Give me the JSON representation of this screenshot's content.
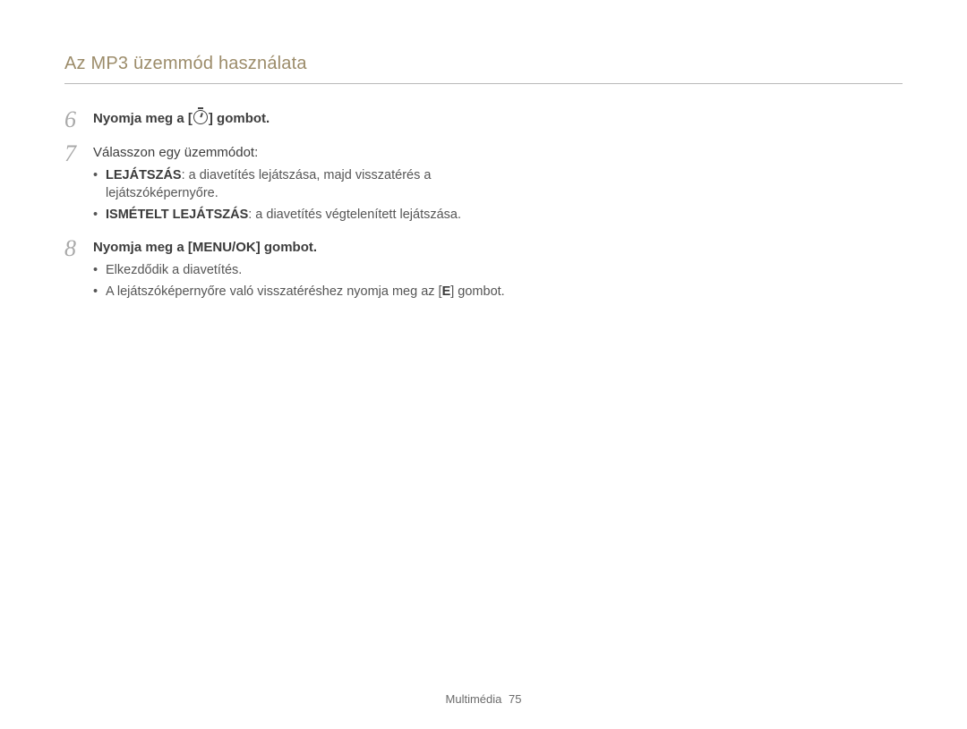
{
  "header": {
    "title": "Az MP3 üzemmód használata"
  },
  "steps": [
    {
      "num": "6",
      "head_pre": "Nyomja meg a [",
      "head_post": "] gombot.",
      "icon": "timer-icon"
    },
    {
      "num": "7",
      "head": "Válasszon egy üzemmódot:",
      "bullets": [
        {
          "bold": "LEJÁTSZÁS",
          "rest": ": a diavetítés lejátszása, majd visszatérés a lejátszóképernyőre."
        },
        {
          "bold": "ISMÉTELT LEJÁTSZÁS",
          "rest": ": a diavetítés végtelenített lejátszása."
        }
      ]
    },
    {
      "num": "8",
      "head_parts": [
        "Nyomja meg a [",
        "MENU/OK",
        "] gombot."
      ],
      "bullets_plain": [
        "Elkezdődik a diavetítés.",
        {
          "pre": "A lejátszóképernyőre való visszatéréshez nyomja meg az [",
          "bold": "E",
          "post": "] gombot."
        }
      ]
    }
  ],
  "footer": {
    "section": "Multimédia",
    "page": "75"
  }
}
